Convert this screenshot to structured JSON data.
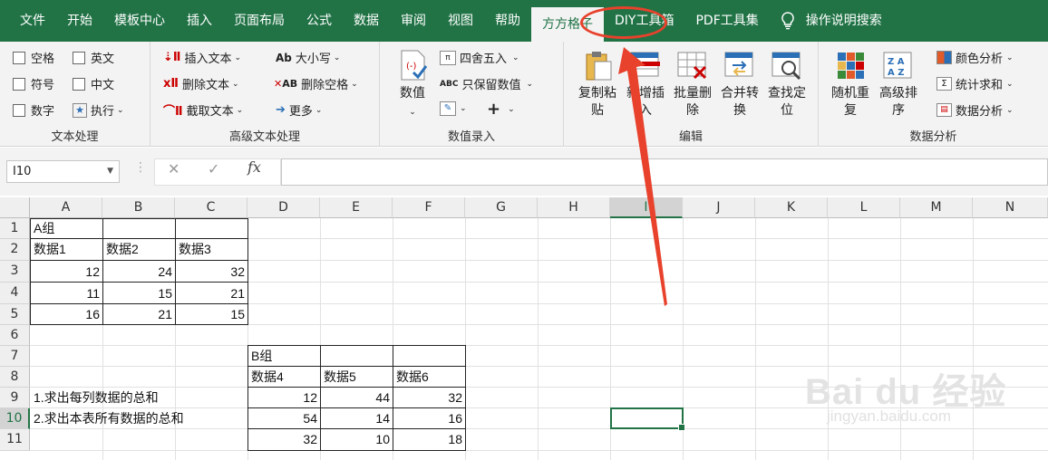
{
  "tabs": [
    "文件",
    "开始",
    "模板中心",
    "插入",
    "页面布局",
    "公式",
    "数据",
    "审阅",
    "视图",
    "帮助",
    "方方格子",
    "DIY工具箱",
    "PDF工具集"
  ],
  "search_tab": "操作说明搜索",
  "groups": {
    "text": "文本处理",
    "adv_text": "高级文本处理",
    "num_input": "数值录入",
    "edit": "编辑",
    "analysis": "数据分析"
  },
  "text_opts": {
    "space": "空格",
    "english": "英文",
    "symbol": "符号",
    "chinese": "中文",
    "digit": "数字",
    "execute": "执行"
  },
  "adv_text": {
    "insert": "插入文本",
    "delete": "删除文本",
    "extract": "截取文本",
    "case": "大小写",
    "del_space": "删除空格",
    "more": "更多"
  },
  "num_input": {
    "value_btn": "数值",
    "round": "四舍五入",
    "keep_value": "只保留数值"
  },
  "edit": {
    "copy_paste": "复制粘\n贴",
    "new_insert": "新增插\n入",
    "batch_delete": "批量删\n除",
    "merge_convert": "合并转\n换",
    "find_locate": "查找定\n位"
  },
  "analysis": {
    "random": "随机重\n复",
    "sort": "高级排\n序",
    "color": "颜色分析",
    "stats": "统计求和",
    "data": "数据分析"
  },
  "name_box": "I10",
  "columns": [
    "A",
    "B",
    "C",
    "D",
    "E",
    "F",
    "G",
    "H",
    "I",
    "J",
    "K",
    "L",
    "M",
    "N"
  ],
  "rows": [
    "1",
    "2",
    "3",
    "4",
    "5",
    "6",
    "7",
    "8",
    "9",
    "10",
    "11"
  ],
  "cells": {
    "a1": "A组",
    "a2": "数据1",
    "b2": "数据2",
    "c2": "数据3",
    "a3": "12",
    "b3": "24",
    "c3": "32",
    "a4": "11",
    "b4": "15",
    "c4": "21",
    "a5": "16",
    "b5": "21",
    "c5": "15",
    "d7": "B组",
    "d8": "数据4",
    "e8": "数据5",
    "f8": "数据6",
    "a9": "1.求出每列数据的总和",
    "a10": "2.求出本表所有数据的总和",
    "d9": "12",
    "e9": "44",
    "f9": "32",
    "d10": "54",
    "e10": "14",
    "f10": "16",
    "d11": "32",
    "e11": "10",
    "f11": "18"
  },
  "watermark": {
    "brand": "Bai du 经验",
    "url": "jingyan.baidu.com"
  },
  "colors": {
    "excel_green": "#217346",
    "highlight_red": "#e8412c"
  }
}
